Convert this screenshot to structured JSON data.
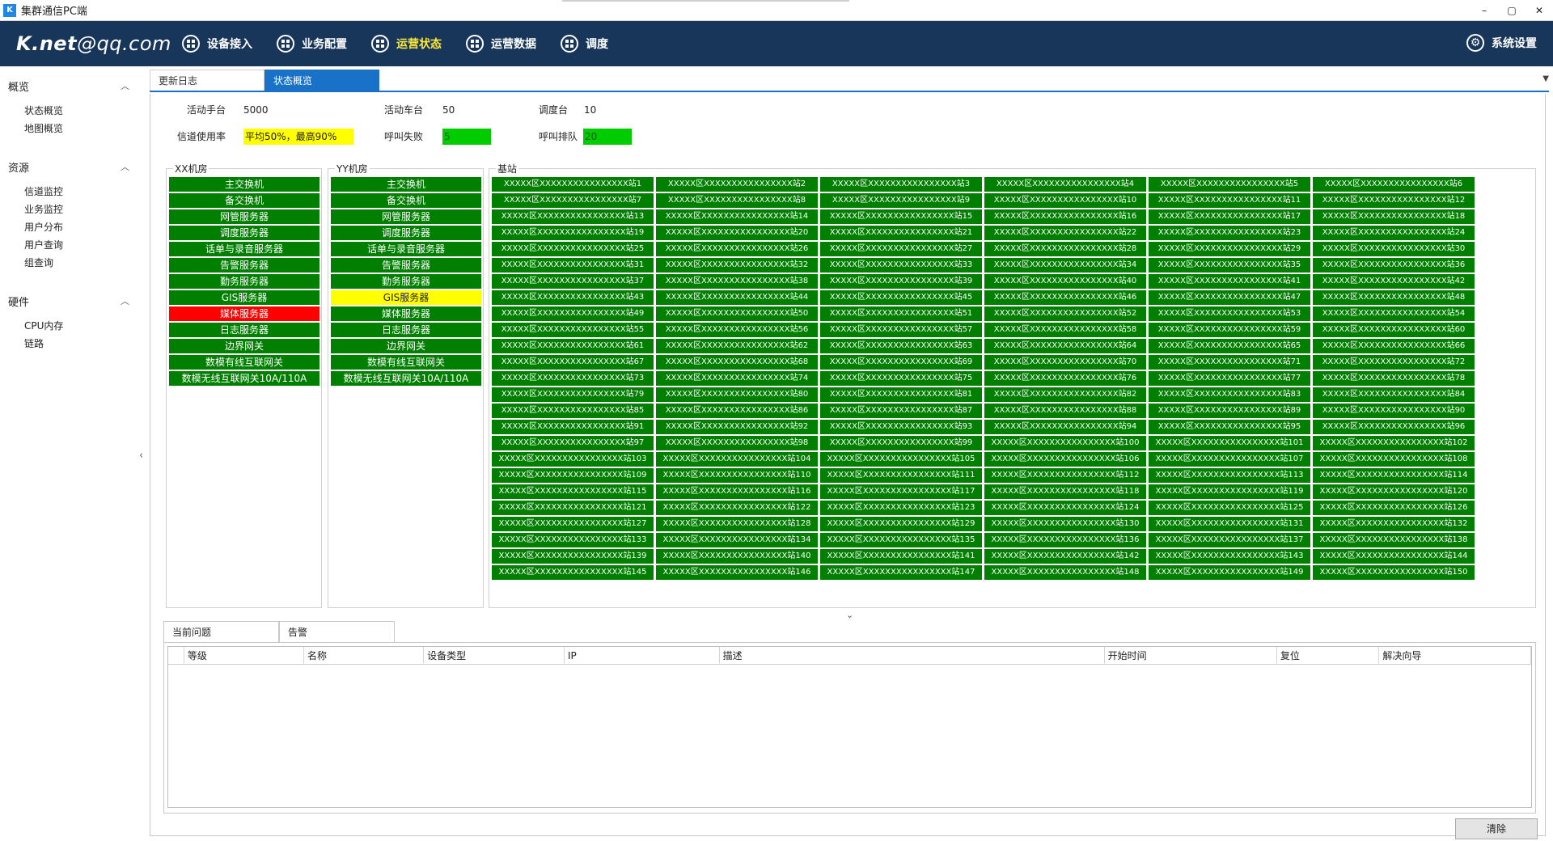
{
  "window": {
    "title": "集群通信PC端",
    "controls": [
      "–",
      "▢",
      "✕"
    ]
  },
  "nav": {
    "logo_bold": "K.net",
    "logo_rest": "@qq.com",
    "items": [
      {
        "label": "设备接入",
        "active": false
      },
      {
        "label": "业务配置",
        "active": false
      },
      {
        "label": "运营状态",
        "active": true
      },
      {
        "label": "运营数据",
        "active": false
      },
      {
        "label": "调度",
        "active": false
      }
    ],
    "settings_label": "系统设置",
    "active_color": "#ffea3c",
    "bg_color": "#17365a"
  },
  "sidebar": {
    "groups": [
      {
        "title": "概览",
        "items": [
          "状态概览",
          "地图概览"
        ]
      },
      {
        "title": "资源",
        "items": [
          "信道监控",
          "业务监控",
          "用户分布",
          "用户查询",
          "组查询"
        ]
      },
      {
        "title": "硬件",
        "items": [
          "CPU内存",
          "链路"
        ]
      }
    ]
  },
  "tabs": [
    {
      "label": "更新日志",
      "active": false
    },
    {
      "label": "状态概览",
      "active": true
    }
  ],
  "stats": {
    "handset_label": "活动手台",
    "handset_value": "5000",
    "vehicle_label": "活动车台",
    "vehicle_value": "50",
    "dispatch_label": "调度台",
    "dispatch_value": "10",
    "channel_label": "信道使用率",
    "channel_value": "平均50%，最高90%",
    "callfail_label": "呼叫失败",
    "callfail_value": "5",
    "queue_label": "呼叫排队",
    "queue_value": "20"
  },
  "rooms": [
    {
      "title": "XX机房",
      "servers": [
        {
          "name": "主交换机",
          "status": "ok"
        },
        {
          "name": "备交换机",
          "status": "ok"
        },
        {
          "name": "网管服务器",
          "status": "ok"
        },
        {
          "name": "调度服务器",
          "status": "ok"
        },
        {
          "name": "话单与录音服务器",
          "status": "ok"
        },
        {
          "name": "告警服务器",
          "status": "ok"
        },
        {
          "name": "勤务服务器",
          "status": "ok"
        },
        {
          "name": "GIS服务器",
          "status": "ok"
        },
        {
          "name": "媒体服务器",
          "status": "error"
        },
        {
          "name": "日志服务器",
          "status": "ok"
        },
        {
          "name": "边界网关",
          "status": "ok"
        },
        {
          "name": "数模有线互联网关",
          "status": "ok"
        },
        {
          "name": "数模无线互联网关10A/110A",
          "status": "ok"
        }
      ]
    },
    {
      "title": "YY机房",
      "servers": [
        {
          "name": "主交换机",
          "status": "ok"
        },
        {
          "name": "备交换机",
          "status": "ok"
        },
        {
          "name": "网管服务器",
          "status": "ok"
        },
        {
          "name": "调度服务器",
          "status": "ok"
        },
        {
          "name": "话单与录音服务器",
          "status": "ok"
        },
        {
          "name": "告警服务器",
          "status": "ok"
        },
        {
          "name": "勤务服务器",
          "status": "ok"
        },
        {
          "name": "GIS服务器",
          "status": "warning"
        },
        {
          "name": "媒体服务器",
          "status": "ok"
        },
        {
          "name": "日志服务器",
          "status": "ok"
        },
        {
          "name": "边界网关",
          "status": "ok"
        },
        {
          "name": "数模有线互联网关",
          "status": "ok"
        },
        {
          "name": "数模无线互联网关10A/110A",
          "status": "ok"
        }
      ]
    }
  ],
  "stations": {
    "title": "基站",
    "name_prefix": "XXXXX区XXXXXXXXXXXXXXXX站",
    "count": 150,
    "columns": 6
  },
  "status_colors": {
    "ok": "#007f00",
    "error": "#ff0000",
    "warning": "#ffff00"
  },
  "issues": {
    "tabs": [
      {
        "label": "当前问题",
        "active": true
      },
      {
        "label": "告警",
        "active": false
      }
    ],
    "columns": [
      "等级",
      "名称",
      "设备类型",
      "IP",
      "描述",
      "开始时间",
      "复位",
      "解决向导"
    ],
    "rows": [],
    "clear_label": "清除"
  }
}
